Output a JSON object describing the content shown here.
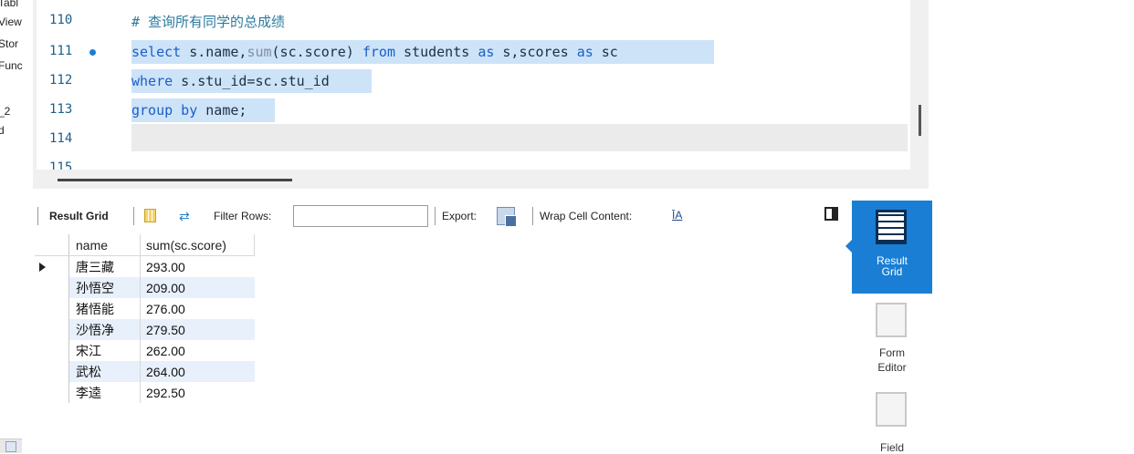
{
  "navigator": {
    "items": [
      {
        "label": "Tabl"
      },
      {
        "label": "View"
      },
      {
        "label": "Stor"
      },
      {
        "label": "Func"
      },
      {
        "label": "_2"
      },
      {
        "label": "d"
      }
    ]
  },
  "editor": {
    "lines": [
      {
        "num": "110",
        "comment": "# 查询所有同学的总成绩"
      },
      {
        "num": "111",
        "has_dot": true
      },
      {
        "num": "112"
      },
      {
        "num": "113"
      },
      {
        "num": "114"
      },
      {
        "num": "115"
      }
    ],
    "line111": {
      "kw_select": "select",
      "t1": " s.name,",
      "fn_sum": "sum",
      "t2": "(sc.score) ",
      "kw_from": "from",
      "t3": " students ",
      "kw_as1": "as",
      "t4": " s,scores ",
      "kw_as2": "as",
      "t5": " sc"
    },
    "line112": {
      "kw_where": "where",
      "t1": " s.stu_id=sc.stu_id"
    },
    "line113": {
      "kw_group": "group by",
      "t1": " name;"
    }
  },
  "toolbar": {
    "result_grid_label": "Result Grid",
    "filter_rows_label": "Filter Rows:",
    "filter_value": "",
    "export_label": "Export:",
    "wrap_label": "Wrap Cell Content:",
    "wrap_icon": "ĪA"
  },
  "grid": {
    "columns": [
      "name",
      "sum(sc.score)"
    ],
    "rows": [
      {
        "name": "唐三藏",
        "score": "293.00"
      },
      {
        "name": "孙悟空",
        "score": "209.00"
      },
      {
        "name": "猪悟能",
        "score": "276.00"
      },
      {
        "name": "沙悟净",
        "score": "279.50"
      },
      {
        "name": "宋江",
        "score": "262.00"
      },
      {
        "name": "武松",
        "score": "264.00"
      },
      {
        "name": "李逵",
        "score": "292.50"
      }
    ]
  },
  "side_panel": {
    "result_grid_l1": "Result",
    "result_grid_l2": "Grid",
    "form_editor_l1": "Form",
    "form_editor_l2": "Editor",
    "field_l1": "Field"
  },
  "colors": {
    "accent": "#1a7fd4",
    "selection": "#cde3f8",
    "keyword": "#1a5fc6"
  }
}
